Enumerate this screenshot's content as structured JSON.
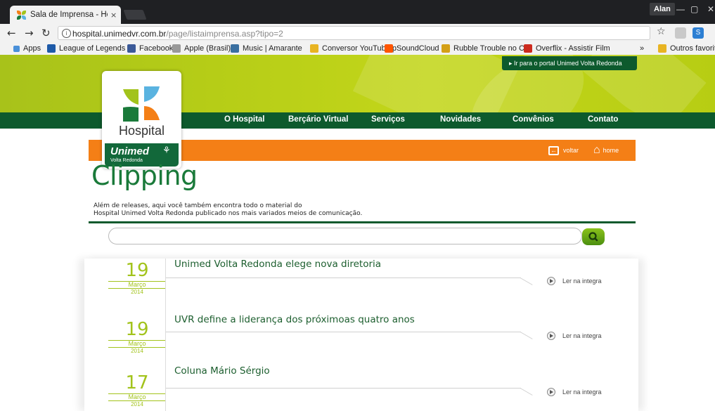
{
  "browser": {
    "tab_title": "Sala de Imprensa - Hosp",
    "tab_close": "×",
    "user_name": "Alan",
    "url_main": "hospital.unimedvr.com.br",
    "url_path": "/page/listaimprensa.asp?tipo=2",
    "bookmarks": [
      {
        "label": "Apps",
        "color": "#4a90d9"
      },
      {
        "label": "League of Legends",
        "color": "#1e5aa8"
      },
      {
        "label": "Facebook",
        "color": "#3b5998"
      },
      {
        "label": "Apple (Brasil)",
        "color": "#999999"
      },
      {
        "label": "Music | Amarante",
        "color": "#3a6fa0"
      },
      {
        "label": "Conversor YouTube p",
        "color": "#e8b423"
      },
      {
        "label": "SoundCloud",
        "color": "#ff5500"
      },
      {
        "label": "Rubble Trouble no Cl",
        "color": "#d4a017"
      },
      {
        "label": "Overflix - Assistir Film",
        "color": "#cc2b1e"
      }
    ],
    "bookmarks_more": "»",
    "other_bookmarks": "Outros favoritos"
  },
  "site": {
    "portal_link": "▸ Ir para o portal Unimed Volta Redonda",
    "logo_hospital": "Hospital",
    "logo_unimed": "Unimed",
    "logo_city": "Volta Redonda",
    "menu": [
      "O Hospital",
      "Berçário Virtual",
      "Serviços",
      "Novidades",
      "Convênios",
      "Contato"
    ],
    "voltar": "voltar",
    "home": "home",
    "page_title": "Clipping",
    "desc_line1": "Além de releases, aqui você também encontra todo o material do",
    "desc_line2": "Hospital Unimed Volta Redonda publicado nos mais variados meios de comunicação.",
    "search_placeholder": ""
  },
  "news": [
    {
      "day": "19",
      "month": "Março",
      "year": "2014",
      "title": "Unimed Volta Redonda elege nova diretoria",
      "read_more": "Ler na integra"
    },
    {
      "day": "19",
      "month": "Março",
      "year": "2014",
      "title": "UVR define a liderança dos próximoas quatro anos",
      "read_more": "Ler na integra"
    },
    {
      "day": "17",
      "month": "Março",
      "year": "2014",
      "title": "Coluna Mário Sérgio",
      "read_more": "Ler na integra"
    }
  ]
}
